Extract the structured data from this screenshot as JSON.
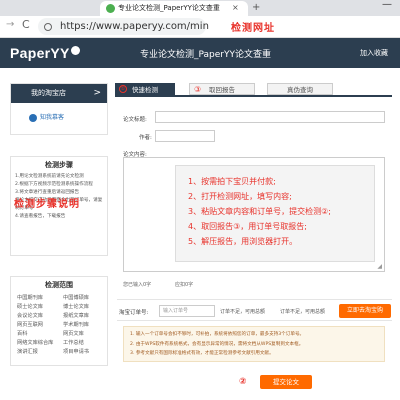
{
  "browser": {
    "tab_title": "专业论文检测_PaperYY论文查重",
    "tab_close": "×",
    "tab_new": "+",
    "window_min": "—",
    "url": "https://www.paperyy.com/min",
    "url_annotation": "检测网址",
    "nav_forward": "→",
    "nav_reload": "C"
  },
  "header": {
    "logo": "PaperYY",
    "title": "专业论文检测_PaperYY论文查重",
    "favorite": "加入收藏"
  },
  "sidebar": {
    "shop_button": "我的淘宝店",
    "shop_arrow": ">",
    "shop_logo": "知我慕客",
    "steps_title": "检测步骤",
    "steps": [
      "1.用论文检测系统前请先论文检测",
      "2.根据下方视频示范检测系统操作流程",
      "3.将文章进行查重后请返回报告",
      "将论文提交成功后页面会出现订单号，请复制订单号",
      "4.请查看报告，下载报告"
    ],
    "steps_annotation": "检测步骤说明",
    "range_title": "检测范围",
    "range_items": [
      "中国期刊库",
      "中国博硕库",
      "硕士论文库",
      "博士论文库",
      "会议论文库",
      "报纸文章库",
      "网页互联网",
      "学术期刊库",
      "百科",
      "网页文库",
      "网络文库综合库",
      "工作总结",
      "演讲汇报",
      "项目申请书"
    ]
  },
  "main": {
    "tabs": [
      {
        "label": "快速检测",
        "num": "①"
      },
      {
        "label": "取回报告",
        "num": "③"
      },
      {
        "label": "真伪查询"
      }
    ],
    "title_label": "论文标题:",
    "author_label": "作者:",
    "content_label": "论文内容:",
    "guide": [
      "1、按需拍下宝贝并付款;",
      "2、打开检测网址，填写内容;",
      "3、粘贴文章内容和订单号，提交检测②;",
      "4、取回报告③，用订单号取报告;",
      "5、解压报告，用浏览器打开。"
    ],
    "count_label": "您已输入0字",
    "count_label2": "应扣0字",
    "order_label": "淘宝订单号:",
    "order_placeholder": "输入订单号",
    "order_hint1": "订单不足，可用总额",
    "order_hint2": "订单不足，可用总额",
    "taobao_button": "立即去淘宝购",
    "notes": [
      "1. 输入一个订单号会扣不够时，可补拍，系统将依照您的订单，最多支持3个订单号。",
      "2. 由于WPS软件有系统格式，会有显示异常的情况，需将文档从WPS复制到文本框。",
      "3. 参考文献只有国际标准格式有效，才能正常检测参考文献引用文献。"
    ],
    "submit_num": "②",
    "submit_button": "提交论文"
  },
  "colors": {
    "header_bg": "#2c3e50",
    "accent_orange": "#ff6a00",
    "annotation_red": "#e8322b"
  }
}
